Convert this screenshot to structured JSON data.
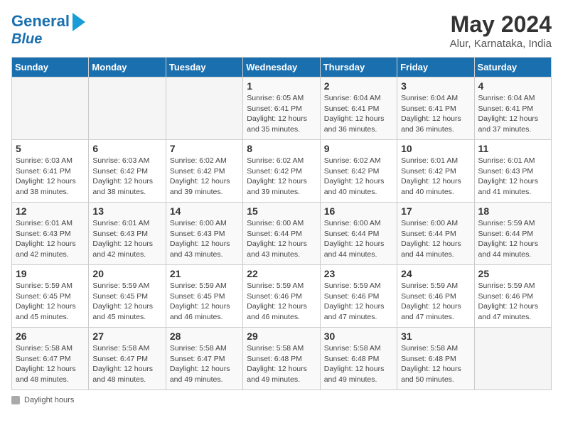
{
  "header": {
    "logo_line1": "General",
    "logo_line2": "Blue",
    "month_title": "May 2024",
    "location": "Alur, Karnataka, India"
  },
  "weekdays": [
    "Sunday",
    "Monday",
    "Tuesday",
    "Wednesday",
    "Thursday",
    "Friday",
    "Saturday"
  ],
  "weeks": [
    [
      {
        "day": "",
        "info": ""
      },
      {
        "day": "",
        "info": ""
      },
      {
        "day": "",
        "info": ""
      },
      {
        "day": "1",
        "info": "Sunrise: 6:05 AM\nSunset: 6:41 PM\nDaylight: 12 hours\nand 35 minutes."
      },
      {
        "day": "2",
        "info": "Sunrise: 6:04 AM\nSunset: 6:41 PM\nDaylight: 12 hours\nand 36 minutes."
      },
      {
        "day": "3",
        "info": "Sunrise: 6:04 AM\nSunset: 6:41 PM\nDaylight: 12 hours\nand 36 minutes."
      },
      {
        "day": "4",
        "info": "Sunrise: 6:04 AM\nSunset: 6:41 PM\nDaylight: 12 hours\nand 37 minutes."
      }
    ],
    [
      {
        "day": "5",
        "info": "Sunrise: 6:03 AM\nSunset: 6:41 PM\nDaylight: 12 hours\nand 38 minutes."
      },
      {
        "day": "6",
        "info": "Sunrise: 6:03 AM\nSunset: 6:42 PM\nDaylight: 12 hours\nand 38 minutes."
      },
      {
        "day": "7",
        "info": "Sunrise: 6:02 AM\nSunset: 6:42 PM\nDaylight: 12 hours\nand 39 minutes."
      },
      {
        "day": "8",
        "info": "Sunrise: 6:02 AM\nSunset: 6:42 PM\nDaylight: 12 hours\nand 39 minutes."
      },
      {
        "day": "9",
        "info": "Sunrise: 6:02 AM\nSunset: 6:42 PM\nDaylight: 12 hours\nand 40 minutes."
      },
      {
        "day": "10",
        "info": "Sunrise: 6:01 AM\nSunset: 6:42 PM\nDaylight: 12 hours\nand 40 minutes."
      },
      {
        "day": "11",
        "info": "Sunrise: 6:01 AM\nSunset: 6:43 PM\nDaylight: 12 hours\nand 41 minutes."
      }
    ],
    [
      {
        "day": "12",
        "info": "Sunrise: 6:01 AM\nSunset: 6:43 PM\nDaylight: 12 hours\nand 42 minutes."
      },
      {
        "day": "13",
        "info": "Sunrise: 6:01 AM\nSunset: 6:43 PM\nDaylight: 12 hours\nand 42 minutes."
      },
      {
        "day": "14",
        "info": "Sunrise: 6:00 AM\nSunset: 6:43 PM\nDaylight: 12 hours\nand 43 minutes."
      },
      {
        "day": "15",
        "info": "Sunrise: 6:00 AM\nSunset: 6:44 PM\nDaylight: 12 hours\nand 43 minutes."
      },
      {
        "day": "16",
        "info": "Sunrise: 6:00 AM\nSunset: 6:44 PM\nDaylight: 12 hours\nand 44 minutes."
      },
      {
        "day": "17",
        "info": "Sunrise: 6:00 AM\nSunset: 6:44 PM\nDaylight: 12 hours\nand 44 minutes."
      },
      {
        "day": "18",
        "info": "Sunrise: 5:59 AM\nSunset: 6:44 PM\nDaylight: 12 hours\nand 44 minutes."
      }
    ],
    [
      {
        "day": "19",
        "info": "Sunrise: 5:59 AM\nSunset: 6:45 PM\nDaylight: 12 hours\nand 45 minutes."
      },
      {
        "day": "20",
        "info": "Sunrise: 5:59 AM\nSunset: 6:45 PM\nDaylight: 12 hours\nand 45 minutes."
      },
      {
        "day": "21",
        "info": "Sunrise: 5:59 AM\nSunset: 6:45 PM\nDaylight: 12 hours\nand 46 minutes."
      },
      {
        "day": "22",
        "info": "Sunrise: 5:59 AM\nSunset: 6:46 PM\nDaylight: 12 hours\nand 46 minutes."
      },
      {
        "day": "23",
        "info": "Sunrise: 5:59 AM\nSunset: 6:46 PM\nDaylight: 12 hours\nand 47 minutes."
      },
      {
        "day": "24",
        "info": "Sunrise: 5:59 AM\nSunset: 6:46 PM\nDaylight: 12 hours\nand 47 minutes."
      },
      {
        "day": "25",
        "info": "Sunrise: 5:59 AM\nSunset: 6:46 PM\nDaylight: 12 hours\nand 47 minutes."
      }
    ],
    [
      {
        "day": "26",
        "info": "Sunrise: 5:58 AM\nSunset: 6:47 PM\nDaylight: 12 hours\nand 48 minutes."
      },
      {
        "day": "27",
        "info": "Sunrise: 5:58 AM\nSunset: 6:47 PM\nDaylight: 12 hours\nand 48 minutes."
      },
      {
        "day": "28",
        "info": "Sunrise: 5:58 AM\nSunset: 6:47 PM\nDaylight: 12 hours\nand 49 minutes."
      },
      {
        "day": "29",
        "info": "Sunrise: 5:58 AM\nSunset: 6:48 PM\nDaylight: 12 hours\nand 49 minutes."
      },
      {
        "day": "30",
        "info": "Sunrise: 5:58 AM\nSunset: 6:48 PM\nDaylight: 12 hours\nand 49 minutes."
      },
      {
        "day": "31",
        "info": "Sunrise: 5:58 AM\nSunset: 6:48 PM\nDaylight: 12 hours\nand 50 minutes."
      },
      {
        "day": "",
        "info": ""
      }
    ]
  ],
  "footer": {
    "daylight_label": "Daylight hours"
  },
  "colors": {
    "header_bg": "#1a6faf",
    "logo_blue": "#1a6faf",
    "logo_arrow": "#1a9cd8"
  }
}
